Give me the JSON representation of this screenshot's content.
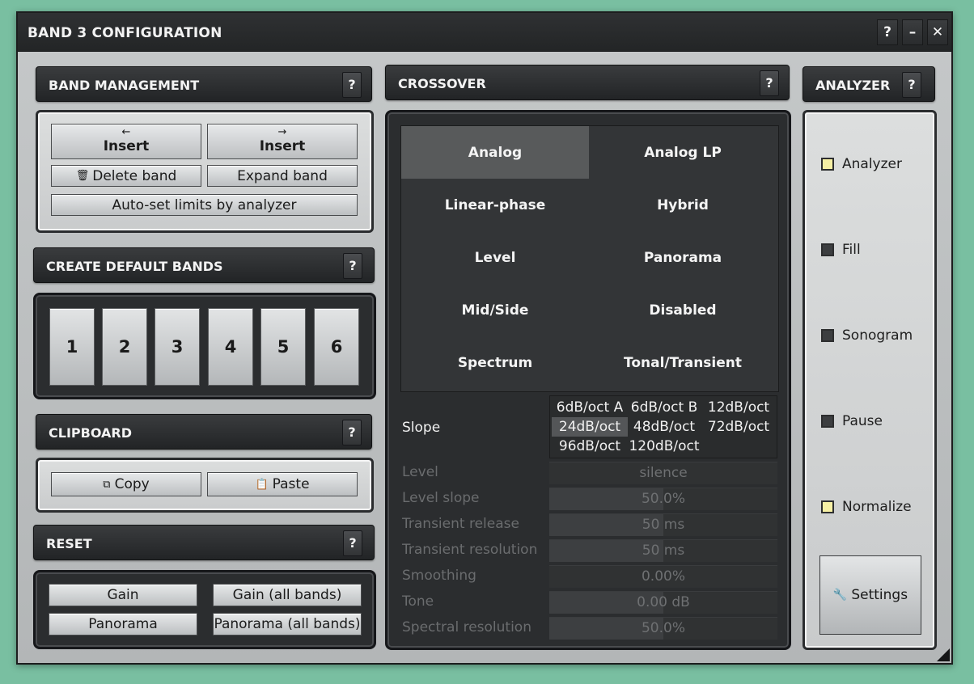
{
  "window": {
    "title": "BAND 3 CONFIGURATION",
    "help_label": "?",
    "minimize_label": "–",
    "close_label": "✕"
  },
  "band_management": {
    "header": "BAND MANAGEMENT",
    "help": "?",
    "insert_left": {
      "arrow": "←",
      "label": "Insert"
    },
    "insert_right": {
      "arrow": "→",
      "label": "Insert"
    },
    "delete_icon": "🗑",
    "delete_label": "Delete band",
    "expand_label": "Expand band",
    "autoset_label": "Auto-set limits by analyzer"
  },
  "create_default_bands": {
    "header": "CREATE DEFAULT BANDS",
    "help": "?",
    "buttons": [
      "1",
      "2",
      "3",
      "4",
      "5",
      "6"
    ]
  },
  "clipboard": {
    "header": "CLIPBOARD",
    "help": "?",
    "copy_icon": "⧉",
    "copy_label": "Copy",
    "paste_icon": "📋",
    "paste_label": "Paste"
  },
  "reset": {
    "header": "RESET",
    "help": "?",
    "gain_label": "Gain",
    "gain_all_label": "Gain (all bands)",
    "panorama_label": "Panorama",
    "panorama_all_label": "Panorama (all bands)"
  },
  "crossover": {
    "header": "CROSSOVER",
    "help": "?",
    "selected": "Analog",
    "modes": [
      "Analog",
      "Analog LP",
      "Linear-phase",
      "Hybrid",
      "Level",
      "Panorama",
      "Mid/Side",
      "Disabled",
      "Spectrum",
      "Tonal/Transient"
    ],
    "slope_label": "Slope",
    "slope_selected": "24dB/oct",
    "slopes": [
      "6dB/oct A",
      "6dB/oct B",
      "12dB/oct",
      "24dB/oct",
      "48dB/oct",
      "72dB/oct",
      "96dB/oct",
      "120dB/oct"
    ],
    "params": [
      {
        "label": "Level",
        "value": "silence",
        "fill": 0
      },
      {
        "label": "Level slope",
        "value": "50.0%",
        "fill": 0.5
      },
      {
        "label": "Transient release",
        "value": "50 ms",
        "fill": 0.5
      },
      {
        "label": "Transient resolution",
        "value": "50 ms",
        "fill": 0.5
      },
      {
        "label": "Smoothing",
        "value": "0.00%",
        "fill": 0
      },
      {
        "label": "Tone",
        "value": "0.00 dB",
        "fill": 0.5
      },
      {
        "label": "Spectral resolution",
        "value": "50.0%",
        "fill": 0.5
      }
    ]
  },
  "analyzer": {
    "header": "ANALYZER",
    "help": "?",
    "checks": [
      {
        "label": "Analyzer",
        "checked": true
      },
      {
        "label": "Fill",
        "checked": false
      },
      {
        "label": "Sonogram",
        "checked": false
      },
      {
        "label": "Pause",
        "checked": false
      },
      {
        "label": "Normalize",
        "checked": true
      }
    ],
    "settings_icon": "🔧",
    "settings_label": "Settings"
  },
  "colors": {
    "checked": "#f6f0a4",
    "unchecked": "#3c3e40",
    "background": "#79bfa1"
  }
}
